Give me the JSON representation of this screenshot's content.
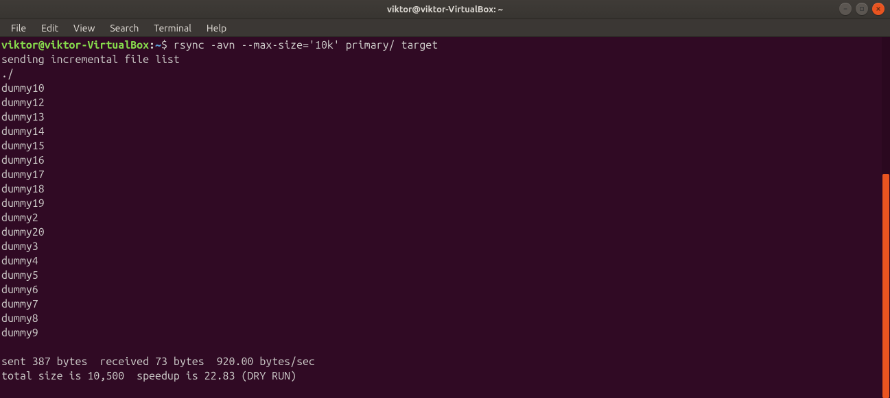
{
  "titlebar": {
    "title": "viktor@viktor-VirtualBox: ~"
  },
  "window_controls": {
    "minimize": "minimize",
    "maximize": "maximize",
    "close": "close"
  },
  "menubar": {
    "items": [
      "File",
      "Edit",
      "View",
      "Search",
      "Terminal",
      "Help"
    ]
  },
  "prompt": {
    "user_host": "viktor@viktor-VirtualBox",
    "colon": ":",
    "path": "~",
    "symbol": "$",
    "command": "rsync -avn --max-size='10k' primary/ target"
  },
  "output": {
    "header": "sending incremental file list",
    "dotslash": "./",
    "files": [
      "dummy10",
      "dummy12",
      "dummy13",
      "dummy14",
      "dummy15",
      "dummy16",
      "dummy17",
      "dummy18",
      "dummy19",
      "dummy2",
      "dummy20",
      "dummy3",
      "dummy4",
      "dummy5",
      "dummy6",
      "dummy7",
      "dummy8",
      "dummy9"
    ],
    "summary1": "sent 387 bytes  received 73 bytes  920.00 bytes/sec",
    "summary2": "total size is 10,500  speedup is 22.83 (DRY RUN)"
  },
  "scrollbar": {
    "thumb_top_pct": 38,
    "thumb_height_pct": 62
  }
}
